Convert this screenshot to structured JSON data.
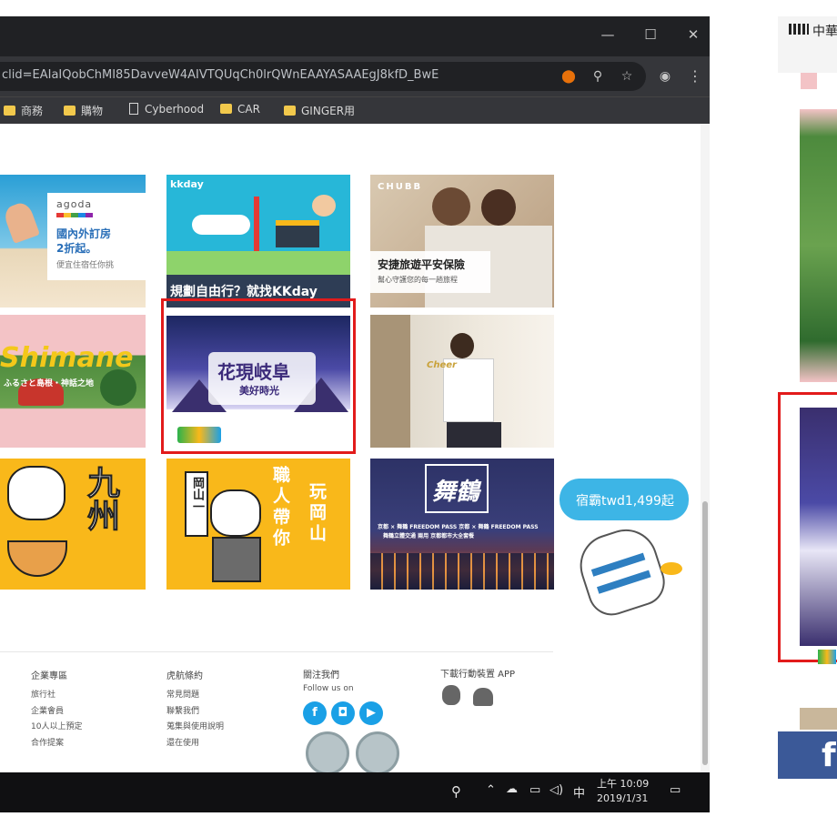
{
  "browser": {
    "url": "clid=EAIaIQobChMI85DavveW4AIVTQUqCh0lrQWnEAAYASAAEgJ8kfD_BwE",
    "window_controls": {
      "minimize": "—",
      "maximize": "☐",
      "close": "✕"
    },
    "icons": {
      "extension": "⬤",
      "zoom": "⚲",
      "star": "☆",
      "account": "◉",
      "menu": "⋮"
    }
  },
  "bookmarks": [
    {
      "label": "商務",
      "type": "folder"
    },
    {
      "label": "購物",
      "type": "folder"
    },
    {
      "label": "Cyberhood",
      "type": "page"
    },
    {
      "label": "CAR",
      "type": "folder"
    },
    {
      "label": "GINGER用",
      "type": "folder"
    }
  ],
  "tiles": {
    "agoda": {
      "brand": "agoda",
      "line1": "國內外訂房",
      "line2": "2折起。",
      "line3": "便宜住宿任你挑"
    },
    "kkday": {
      "brand": "kkday",
      "caption": "規劃自由行？就找KKday"
    },
    "chubb": {
      "brand": "CHUBB",
      "line1": "安捷旅遊平安保險",
      "line2": "幫心守護您的每一趟旅程"
    },
    "shimane": {
      "title": "Shimane",
      "subtitle": "ふるさと島根・神話之地"
    },
    "gifu": {
      "title": "花現岐阜",
      "subtitle": "美好時光"
    },
    "celeb": {
      "caption": "Cheer"
    },
    "kyushu": {
      "title": "九州"
    },
    "okayama": {
      "sign": "岡山一",
      "col1": "職人帶你",
      "col2": "玩岡山"
    },
    "night": {
      "title": "舞鶴",
      "line1": "京都 × 舞鶴 FREEDOM PASS  京都 × 舞鶴 FREEDOM PASS",
      "line2": "舞鶴立體交通 兩用 京都都市大全套餐"
    }
  },
  "promo": {
    "bubble": "宿霸twd1,499起"
  },
  "colors": {
    "highlight": "#e21b1b",
    "kkday_blue": "#27b7d8",
    "tiger_yellow": "#f9b81a",
    "night_navy": "#2d3266",
    "social_blue": "#1aa0e6"
  },
  "footer": {
    "columns": [
      {
        "heading": "企業專區",
        "links": [
          "旅行社",
          "企業會員",
          "10人以上預定",
          "合作提案"
        ]
      },
      {
        "heading": "虎航條約",
        "links": [
          "常見問題",
          "聯繫我們",
          "蒐集與使用說明",
          "還在使用"
        ]
      }
    ],
    "follow": {
      "heading": "關注我們",
      "subheading": "Follow us on",
      "icons": [
        "f",
        "◘",
        "▶"
      ]
    },
    "app": {
      "heading": "下載行動裝置 APP",
      "icons": [
        "apple-icon",
        "android-icon"
      ]
    }
  },
  "taskbar": {
    "ime": "中",
    "time": "上午 10:09",
    "date": "2019/1/31",
    "tray_icons": [
      "⌃",
      "☁",
      "▭",
      "◁)",
      "▭"
    ]
  },
  "phone": {
    "status": "中華"
  }
}
